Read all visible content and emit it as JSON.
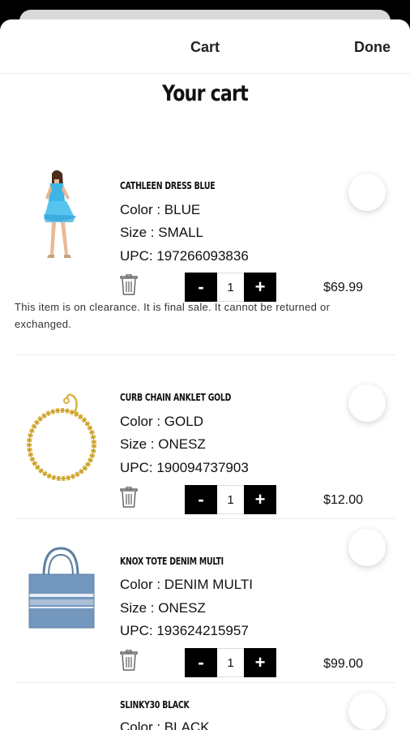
{
  "header": {
    "title": "Cart",
    "done_label": "Done"
  },
  "page_title": "Your cart",
  "items": [
    {
      "name": "CATHLEEN DRESS BLUE",
      "color": "Color : BLUE",
      "size": "Size : SMALL",
      "upc": "UPC: 197266093836",
      "qty_minus": "-",
      "quantity": "1",
      "qty_plus": "+",
      "price": "$69.99",
      "note": "This item is on clearance. It is final sale. It cannot be returned or exchanged."
    },
    {
      "name": "CURB CHAIN ANKLET GOLD",
      "color": "Color : GOLD",
      "size": "Size : ONESZ",
      "upc": "UPC: 190094737903",
      "qty_minus": "-",
      "quantity": "1",
      "qty_plus": "+",
      "price": "$12.00"
    },
    {
      "name": "KNOX TOTE DENIM MULTI",
      "color": "Color : DENIM MULTI",
      "size": "Size : ONESZ",
      "upc": "UPC: 193624215957",
      "qty_minus": "-",
      "quantity": "1",
      "qty_plus": "+",
      "price": "$99.00"
    },
    {
      "name": "SLINKY30 BLACK",
      "color": "Color : BLACK"
    }
  ],
  "icons": {
    "delete": "trash-icon",
    "select": "radio-circle"
  },
  "colors": {
    "accent": "#000000",
    "dress": "#3fb5e6",
    "chain": "#d9b23f",
    "tote": "#6f8fb3"
  }
}
